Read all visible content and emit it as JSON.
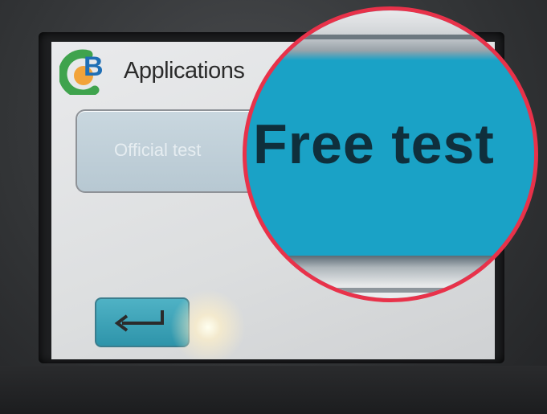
{
  "header": {
    "title": "Applications",
    "logo_letter": "B"
  },
  "buttons": {
    "official_test_label": "Official test",
    "free_test_label": "Free test",
    "back_icon": "return-arrow-icon"
  },
  "magnifier": {
    "zoomed_label": "Free test"
  },
  "colors": {
    "accent_blue": "#1aa2c6",
    "logo_green": "#3fa34d",
    "logo_orange": "#f2a33a",
    "magnifier_ring": "#e8324a"
  }
}
